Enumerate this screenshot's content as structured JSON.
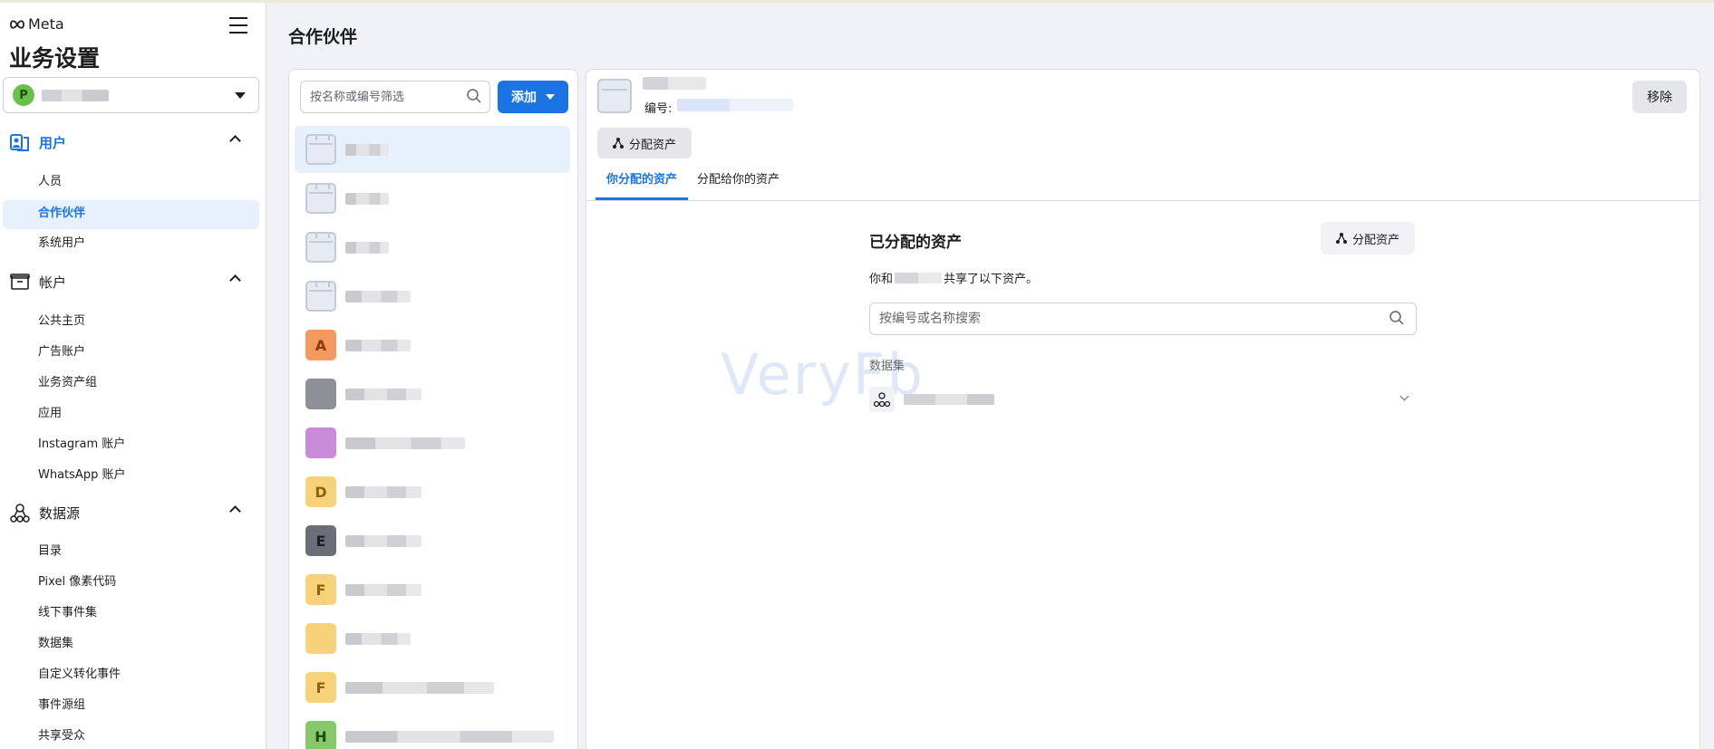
{
  "brand": {
    "name": "Meta"
  },
  "app_title": "业务设置",
  "business_selector": {
    "avatar_letter": "P"
  },
  "sidebar": {
    "sections": [
      {
        "label": "用户",
        "icon": "users-icon",
        "items": [
          {
            "label": "人员"
          },
          {
            "label": "合作伙伴",
            "selected": true
          },
          {
            "label": "系统用户"
          }
        ]
      },
      {
        "label": "帐户",
        "icon": "account-box-icon",
        "items": [
          {
            "label": "公共主页"
          },
          {
            "label": "广告账户"
          },
          {
            "label": "业务资产组"
          },
          {
            "label": "应用"
          },
          {
            "label": "Instagram 账户"
          },
          {
            "label": "WhatsApp 账户"
          }
        ]
      },
      {
        "label": "数据源",
        "icon": "data-sources-icon",
        "items": [
          {
            "label": "目录"
          },
          {
            "label": "Pixel 像素代码"
          },
          {
            "label": "线下事件集"
          },
          {
            "label": "数据集"
          },
          {
            "label": "自定义转化事件"
          },
          {
            "label": "事件源组"
          },
          {
            "label": "共享受众"
          }
        ]
      }
    ]
  },
  "page_title": "合作伙伴",
  "list_panel": {
    "filter_placeholder": "按名称或编号筛选",
    "add_label": "添加",
    "partner_letters": [
      "",
      "",
      "",
      "",
      "A",
      "",
      "",
      "D",
      "E",
      "F",
      "",
      "F",
      "H"
    ]
  },
  "detail": {
    "id_label": "编号:",
    "remove_label": "移除",
    "assign_label": "分配资产",
    "tabs": [
      {
        "label": "你分配的资产",
        "active": true
      },
      {
        "label": "分配给你的资产",
        "active": false
      }
    ],
    "assigned_title": "已分配的资产",
    "assign_label_2": "分配资产",
    "share_prefix": "你和",
    "share_suffix": "共享了以下资产。",
    "asset_search_placeholder": "按编号或名称搜索",
    "dataset_heading": "数据集"
  },
  "watermark": "VeryFb",
  "colors": {
    "accent": "#1b74e4",
    "selected_bg": "#e7f0fd",
    "page_bg": "#f0f2f5",
    "partner_icon_colors": {
      "A": "#f49a5e",
      "D": "#f7d27a",
      "E": "#6b6e76",
      "F": "#f7d27a",
      "H": "#86c96a"
    }
  }
}
